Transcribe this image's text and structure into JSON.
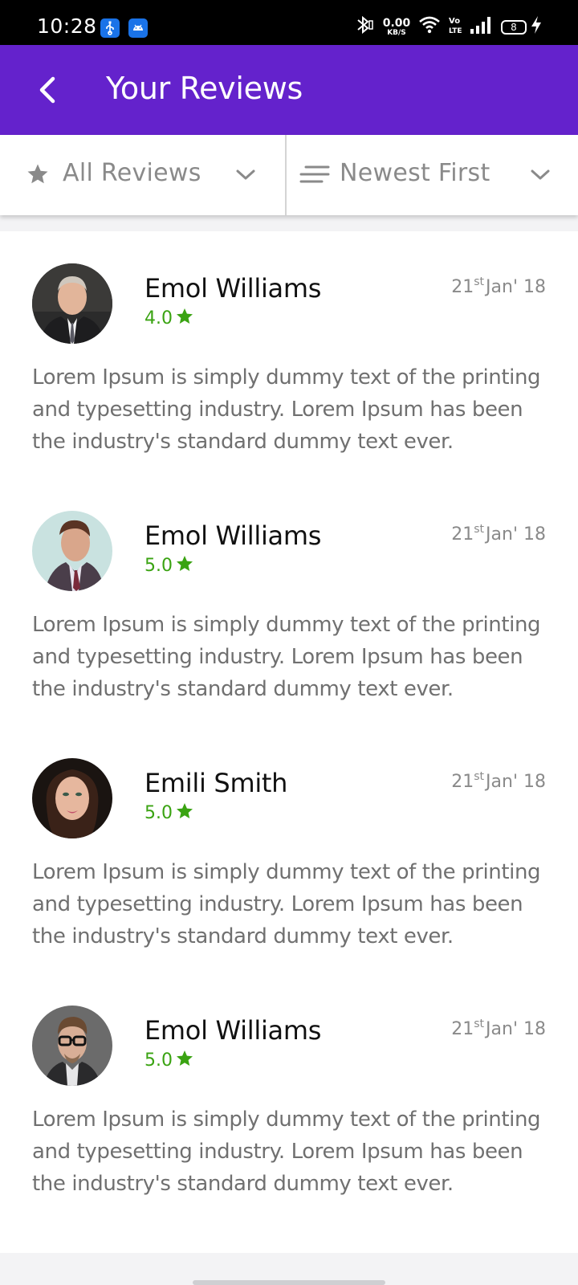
{
  "status_bar": {
    "time": "10:28",
    "net_speed_value": "0.00",
    "net_speed_unit": "KB/S",
    "battery_level": "8",
    "icons": [
      "usb-icon",
      "android-icon",
      "bluetooth-icon",
      "wifi-icon",
      "volte-icon",
      "signal-icon",
      "battery-icon",
      "charging-icon"
    ]
  },
  "app_bar": {
    "title": "Your Reviews",
    "back_icon": "chevron-left-icon",
    "background": "#6422cc"
  },
  "filters": {
    "rating_filter": {
      "icon": "star-icon",
      "label": "All Reviews",
      "chevron": "chevron-down-icon"
    },
    "sort_filter": {
      "icon": "sort-lines-icon",
      "label": "Newest First",
      "chevron": "chevron-down-icon"
    }
  },
  "reviews": [
    {
      "name": "Emol Williams",
      "rating": "4.0",
      "date_day": "21",
      "date_suffix": "st",
      "date_rest": "Jan' 18",
      "text": "Lorem Ipsum is simply dummy text of the printing and typesetting industry. Lorem Ipsum has been the industry's standard dummy text ever."
    },
    {
      "name": "Emol Williams",
      "rating": "5.0",
      "date_day": "21",
      "date_suffix": "st",
      "date_rest": "Jan' 18",
      "text": "Lorem Ipsum is simply dummy text of the printing and typesetting industry. Lorem Ipsum has been the industry's standard dummy text ever."
    },
    {
      "name": "Emili Smith",
      "rating": "5.0",
      "date_day": "21",
      "date_suffix": "st",
      "date_rest": "Jan' 18",
      "text": "Lorem Ipsum is simply dummy text of the printing and typesetting industry. Lorem Ipsum has been the industry's standard dummy text ever."
    },
    {
      "name": "Emol Williams",
      "rating": "5.0",
      "date_day": "21",
      "date_suffix": "st",
      "date_rest": "Jan' 18",
      "text": "Lorem Ipsum is simply dummy text of the printing and typesetting industry. Lorem Ipsum has been the industry's standard dummy text ever."
    }
  ],
  "colors": {
    "accent": "#6422cc",
    "rating_green": "#3aa312",
    "muted_text": "#707070"
  }
}
